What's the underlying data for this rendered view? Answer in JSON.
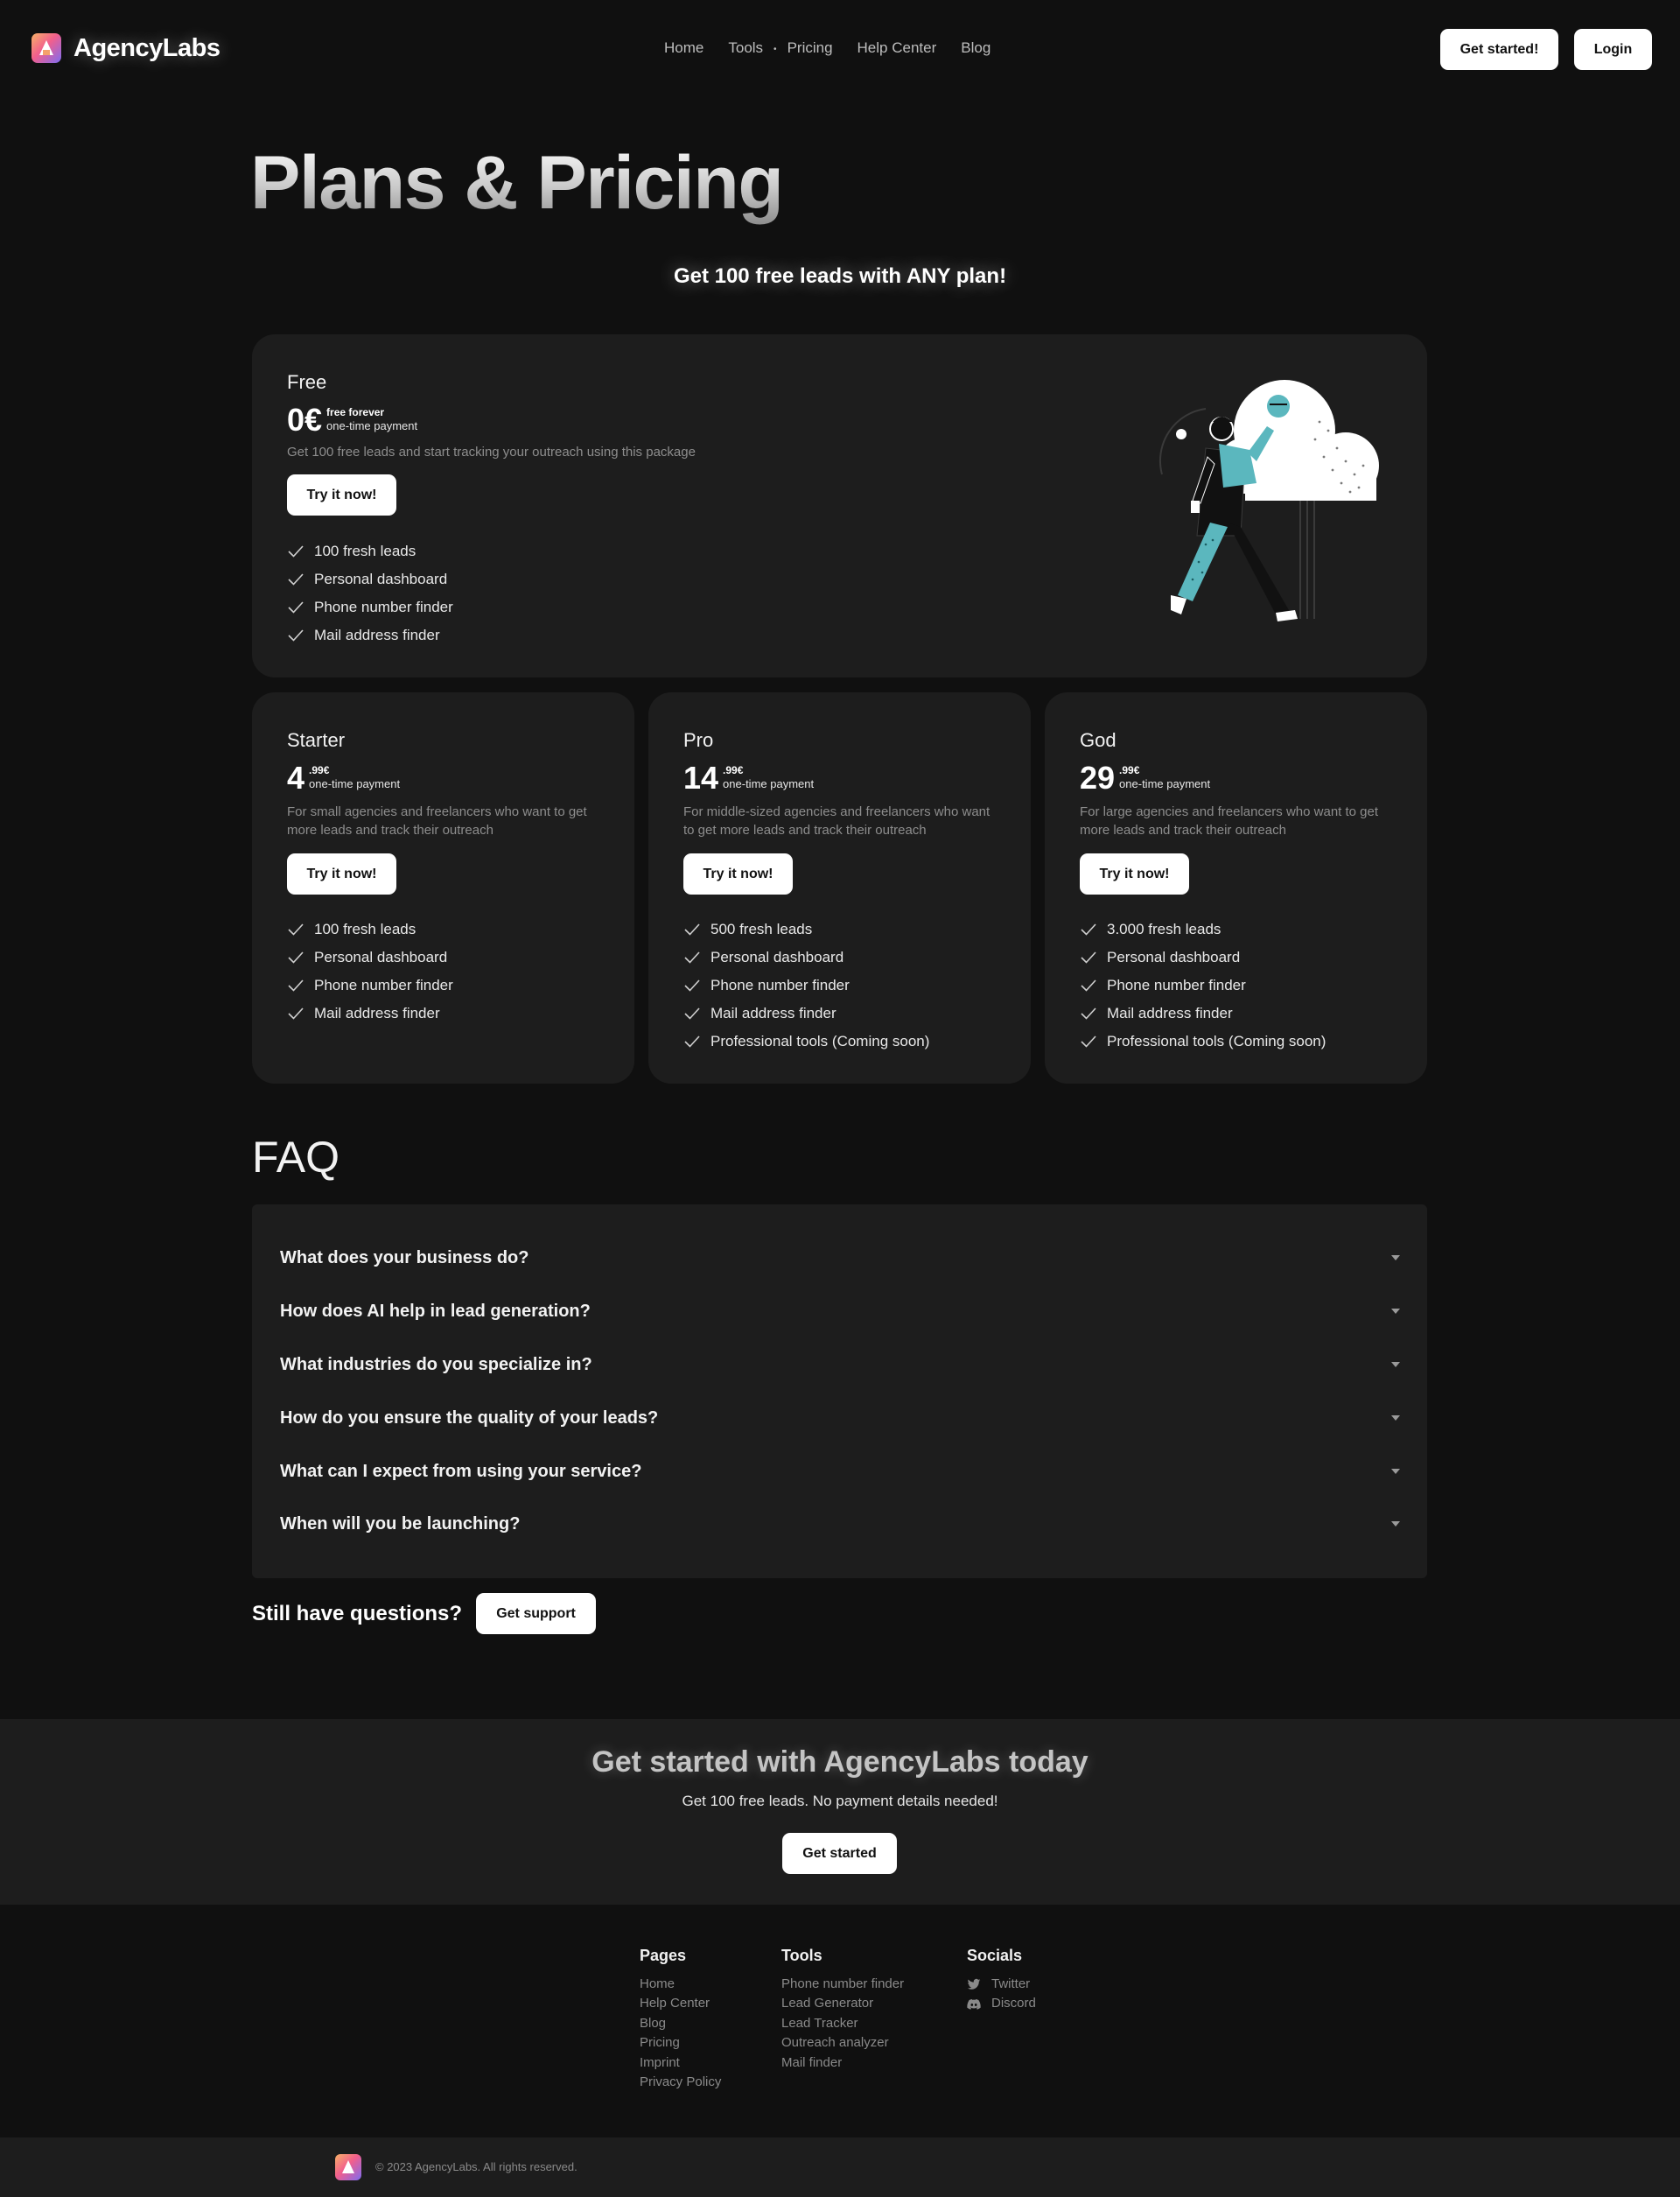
{
  "brand": {
    "name": "AgencyLabs"
  },
  "nav": {
    "items": [
      "Home",
      "Tools",
      "Pricing",
      "Help Center",
      "Blog"
    ],
    "get_started": "Get started!",
    "login": "Login"
  },
  "hero": {
    "title": "Plans & Pricing",
    "subtitle": "Get 100 free leads with ANY plan!"
  },
  "plans": {
    "free": {
      "name": "Free",
      "price": "0€",
      "price_note": "free forever",
      "payment": "one-time payment",
      "description": "Get 100 free leads and start tracking your outreach using this package",
      "button": "Try it now!",
      "features": [
        "100 fresh leads",
        "Personal dashboard",
        "Phone number finder",
        "Mail address finder"
      ]
    },
    "starter": {
      "name": "Starter",
      "price": "4",
      "cents": ".99€",
      "payment": "one-time payment",
      "description": "For small agencies and freelancers who want to get more leads and track their outreach",
      "button": "Try it now!",
      "features": [
        "100 fresh leads",
        "Personal dashboard",
        "Phone number finder",
        "Mail address finder"
      ]
    },
    "pro": {
      "name": "Pro",
      "price": "14",
      "cents": ".99€",
      "payment": "one-time payment",
      "description": "For middle-sized agencies and freelancers who want to get more leads and track their outreach",
      "button": "Try it now!",
      "features": [
        "500 fresh leads",
        "Personal dashboard",
        "Phone number finder",
        "Mail address finder",
        "Professional tools (Coming soon)"
      ]
    },
    "god": {
      "name": "God",
      "price": "29",
      "cents": ".99€",
      "payment": "one-time payment",
      "description": "For large agencies and freelancers who want to get more leads and track their outreach",
      "button": "Try it now!",
      "features": [
        "3.000 fresh leads",
        "Personal dashboard",
        "Phone number finder",
        "Mail address finder",
        "Professional tools (Coming soon)"
      ]
    }
  },
  "faq": {
    "title": "FAQ",
    "questions": [
      "What does your business do?",
      "How does AI help in lead generation?",
      "What industries do you specialize in?",
      "How do you ensure the quality of your leads?",
      "What can I expect from using your service?",
      "When will you be launching?"
    ],
    "still_questions": "Still have questions?",
    "support_button": "Get support"
  },
  "cta": {
    "title": "Get started with AgencyLabs today",
    "subtitle": "Get 100 free leads. No payment details needed!",
    "button": "Get started"
  },
  "footer": {
    "pages": {
      "title": "Pages",
      "links": [
        "Home",
        "Help Center",
        "Blog",
        "Pricing",
        "Imprint",
        "Privacy Policy"
      ]
    },
    "tools": {
      "title": "Tools",
      "links": [
        "Phone number finder",
        "Lead Generator",
        "Lead Tracker",
        "Outreach analyzer",
        "Mail finder"
      ]
    },
    "socials": {
      "title": "Socials",
      "links": [
        "Twitter",
        "Discord"
      ],
      "icons": [
        "twitter-icon",
        "discord-icon"
      ]
    },
    "copyright": "© 2023 AgencyLabs. All rights reserved."
  },
  "colors": {
    "background": "#101010",
    "card": "#1d1d1d",
    "accent_teal": "#5bb7be",
    "button": "#ffffff"
  }
}
